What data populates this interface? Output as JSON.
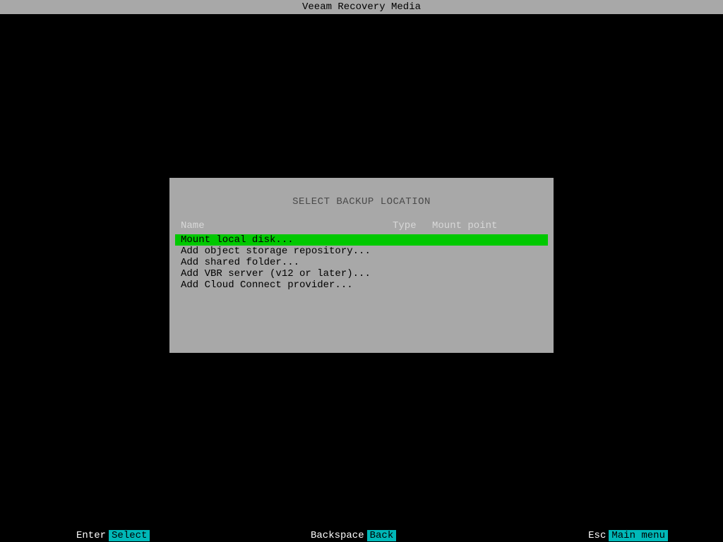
{
  "title_bar": "Veeam Recovery Media",
  "dialog": {
    "title": "SELECT BACKUP LOCATION",
    "columns": {
      "name": "Name",
      "type": "Type",
      "mount_point": "Mount point"
    },
    "items": [
      {
        "label": "Mount local disk...",
        "selected": true
      },
      {
        "label": "Add object storage repository...",
        "selected": false
      },
      {
        "label": "Add shared folder...",
        "selected": false
      },
      {
        "label": "Add VBR server (v12 or later)...",
        "selected": false
      },
      {
        "label": "Add Cloud Connect provider...",
        "selected": false
      }
    ]
  },
  "footer": {
    "enter": {
      "key": "Enter",
      "action": "Select"
    },
    "backspace": {
      "key": "Backspace",
      "action": "Back"
    },
    "esc": {
      "key": "Esc",
      "action": "Main menu"
    }
  }
}
